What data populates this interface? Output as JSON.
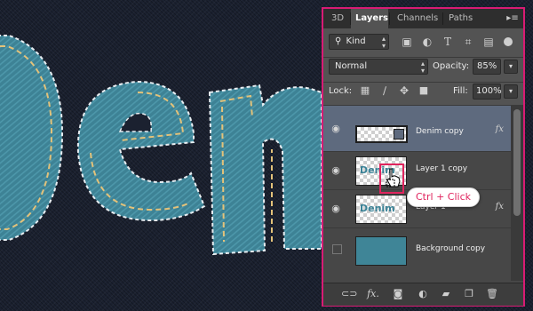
{
  "panel": {
    "tabs": [
      {
        "label": "3D"
      },
      {
        "label": "Layers",
        "active": true
      },
      {
        "label": "Channels"
      },
      {
        "label": "Paths"
      }
    ],
    "menu_icon": "panel-menu-icon",
    "filter": {
      "label": "Kind",
      "icon": "search-icon"
    },
    "filter_icons": [
      "image-filter-icon",
      "adjustment-filter-icon",
      "type-filter-icon",
      "shape-filter-icon",
      "smart-object-filter-icon",
      "filter-toggle-icon"
    ],
    "blend_mode": "Normal",
    "opacity": {
      "label": "Opacity:",
      "value": "85%"
    },
    "lock": {
      "label": "Lock:",
      "icons": [
        "lock-transparent-icon",
        "lock-brush-icon",
        "lock-position-icon",
        "lock-all-icon"
      ]
    },
    "fill": {
      "label": "Fill:",
      "value": "100%"
    },
    "layers": [
      {
        "name": "Denim copy",
        "visible": true,
        "selected": true,
        "has_fx": true,
        "fx_label": "fx"
      },
      {
        "name": "Layer 1 copy",
        "visible": true,
        "selected": false,
        "thumb_text": "Denim",
        "has_fx": false
      },
      {
        "name": "Layer 1",
        "visible": true,
        "selected": false,
        "thumb_text": "Denim",
        "has_fx": true,
        "fx_label": "fx"
      },
      {
        "name": "Background copy",
        "visible": false,
        "selected": false,
        "has_fx": false
      }
    ],
    "bottom_icons": [
      "link-layers-icon",
      "fx-icon",
      "mask-icon",
      "adjustment-icon",
      "group-folder-icon",
      "new-layer-icon",
      "trash-icon"
    ],
    "fx_bottom_label": "fx."
  },
  "tooltip": {
    "text": "Ctrl + Click"
  },
  "colors": {
    "highlight": "#e0245e",
    "panel_border": "#d81b74",
    "denim": "#3f8597",
    "stitch": "#e3c27a"
  }
}
